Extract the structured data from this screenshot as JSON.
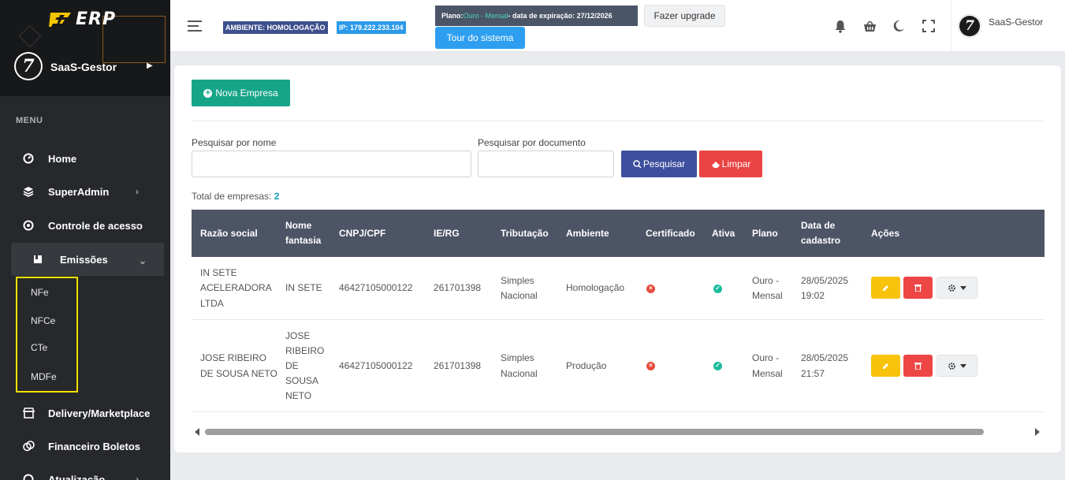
{
  "sidebar": {
    "logo_text": "ERP",
    "user_name": "SaaS-Gestor",
    "avatar_char": "7",
    "menu_title": "MENU",
    "items": [
      {
        "label": "Home",
        "icon": "dashboard-gauge-icon"
      },
      {
        "label": "SuperAdmin",
        "icon": "layers-icon"
      },
      {
        "label": "Controle de acesso",
        "icon": "at-sign-icon"
      },
      {
        "label": "Emissões",
        "icon": "bookmark-icon"
      },
      {
        "label": "Delivery/Marketplace",
        "icon": "store-icon"
      },
      {
        "label": "Financeiro Boletos",
        "icon": "coins-icon"
      },
      {
        "label": "Atualização",
        "icon": "refresh-icon"
      }
    ],
    "subitems": [
      "NFe",
      "NFCe",
      "CTe",
      "MDFe"
    ],
    "highlight_color": "#f5e100"
  },
  "topbar": {
    "env_badge": "AMBIENTE: HOMOLOGAÇÃO",
    "ip_badge": "IP: 179.222.233.104",
    "plan_prefix": "Plano: ",
    "plan_name": "Ouro - Mensal",
    "plan_suffix": " - data de expiração: 27/12/2026",
    "upgrade_label": "Fazer upgrade",
    "tour_label": "Tour do sistema",
    "user_name": "SaaS-Gestor",
    "avatar_char": "7",
    "icons": [
      "bell-icon",
      "basket-icon",
      "moon-icon",
      "fullscreen-icon"
    ]
  },
  "content": {
    "new_button": "Nova Empresa",
    "search_name_label": "Pesquisar por nome",
    "search_doc_label": "Pesquisar por documento",
    "search_name_value": "",
    "search_doc_value": "",
    "search_button": "Pesquisar",
    "clear_button": "Limpar",
    "total_label": "Total de empresas: ",
    "total_value": "2",
    "columns": [
      "Razão social",
      "Nome fantasia",
      "CNPJ/CPF",
      "IE/RG",
      "Tributação",
      "Ambiente",
      "Certificado",
      "Ativa",
      "Plano",
      "Data de cadastro",
      "Ações"
    ],
    "rows": [
      {
        "razao": "IN SETE ACELERADORA LTDA",
        "fantasia": "IN SETE",
        "cnpj": "46427105000122",
        "ie": "261701398",
        "tributacao": "Simples Nacional",
        "ambiente": "Homologação",
        "certificado": "invalid",
        "ativa": "active",
        "plano": "Ouro - Mensal",
        "data": "28/05/2025 19:02"
      },
      {
        "razao": "JOSE RIBEIRO DE SOUSA NETO",
        "fantasia": "JOSE RIBEIRO DE SOUSA NETO",
        "cnpj": "46427105000122",
        "ie": "261701398",
        "tributacao": "Simples Nacional",
        "ambiente": "Produção",
        "certificado": "invalid",
        "ativa": "active",
        "plano": "Ouro - Mensal",
        "data": "28/05/2025 21:57"
      }
    ],
    "colors": {
      "primary": "#17a589",
      "search": "#3d4f9e",
      "danger": "#e94343",
      "warning": "#f9c20b",
      "header": "#4d5466"
    }
  }
}
